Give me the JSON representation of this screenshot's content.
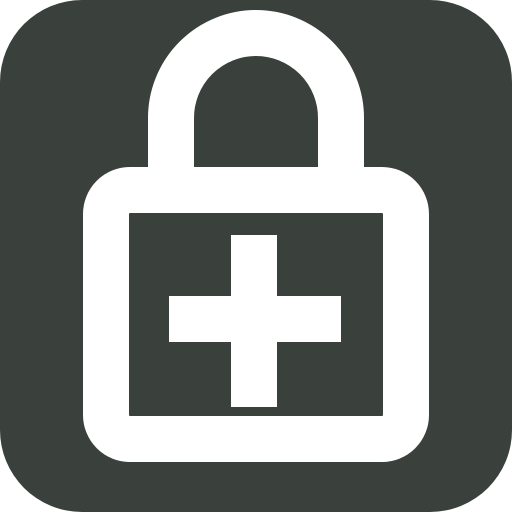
{
  "icon": {
    "name": "lock-plus-icon",
    "background_color": "#3a403c",
    "foreground_color": "#ffffff"
  }
}
